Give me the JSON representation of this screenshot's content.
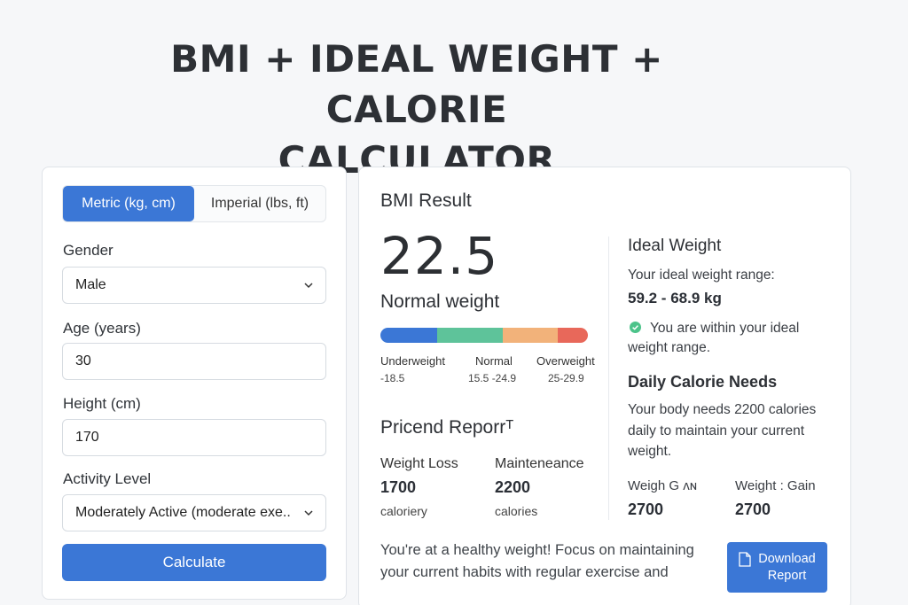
{
  "page": {
    "title_line1": "BMI + IDEAL WEIGHT + CALORIE",
    "title_line2": "CALCULATOR"
  },
  "colors": {
    "accent": "#3b77d6",
    "underweight": "#3b77d6",
    "normal": "#5ec39a",
    "overweight": "#f2b27a",
    "obese": "#e8685a",
    "check": "#4cc38a"
  },
  "form": {
    "units": {
      "metric": "Metric (kg, cm)",
      "imperial": "Imperial (lbs, ft)",
      "selected": "metric"
    },
    "gender": {
      "label": "Gender",
      "value": "Male"
    },
    "age": {
      "label": "Age (years)",
      "value": "30"
    },
    "height": {
      "label": "Height (cm)",
      "value": "170"
    },
    "activity": {
      "label": "Activity Level",
      "value": "Moderately Active (moderate exe.."
    },
    "calculate_label": "Calculate"
  },
  "result": {
    "heading": "BMI Result",
    "bmi": "22.5",
    "category": "Normal weight",
    "scale": [
      {
        "label": "Underweight",
        "range": "-18.5"
      },
      {
        "label": "Normal",
        "range": "15.5 -24.9"
      },
      {
        "label": "Overweight",
        "range": "25-29.9"
      }
    ],
    "report": {
      "heading": "Pricend Reporrᵀ",
      "loss_label": "Weight Loss",
      "loss_value": "1700",
      "loss_unit": "caloriery",
      "maint_label": "Mainteneance",
      "maint_value": "2200",
      "maint_unit": "calories"
    },
    "ideal": {
      "heading": "Ideal  Weight",
      "range_label": "Your ideal weight range:",
      "range_value": "59.2 - 68.9 kg",
      "status_line1": "You are within your ideal",
      "status_line2": "weight range."
    },
    "calories": {
      "heading": "Daily Calorie Needs",
      "line1": "Your body needs 2200 calories",
      "line2": "daily to maintain your current",
      "line3": "weight.",
      "gain1_label": "Weigh G ʌɴ",
      "gain1_value": "2700",
      "gain2_label": "Weight : Gain",
      "gain2_value": "2700"
    },
    "footer_line1": "You're at a healthy weight! Focus on maintaining",
    "footer_line2": "your current habits with regular exercise and",
    "download_line1": "Download",
    "download_line2": "Report",
    "download_icon": "document-icon"
  }
}
